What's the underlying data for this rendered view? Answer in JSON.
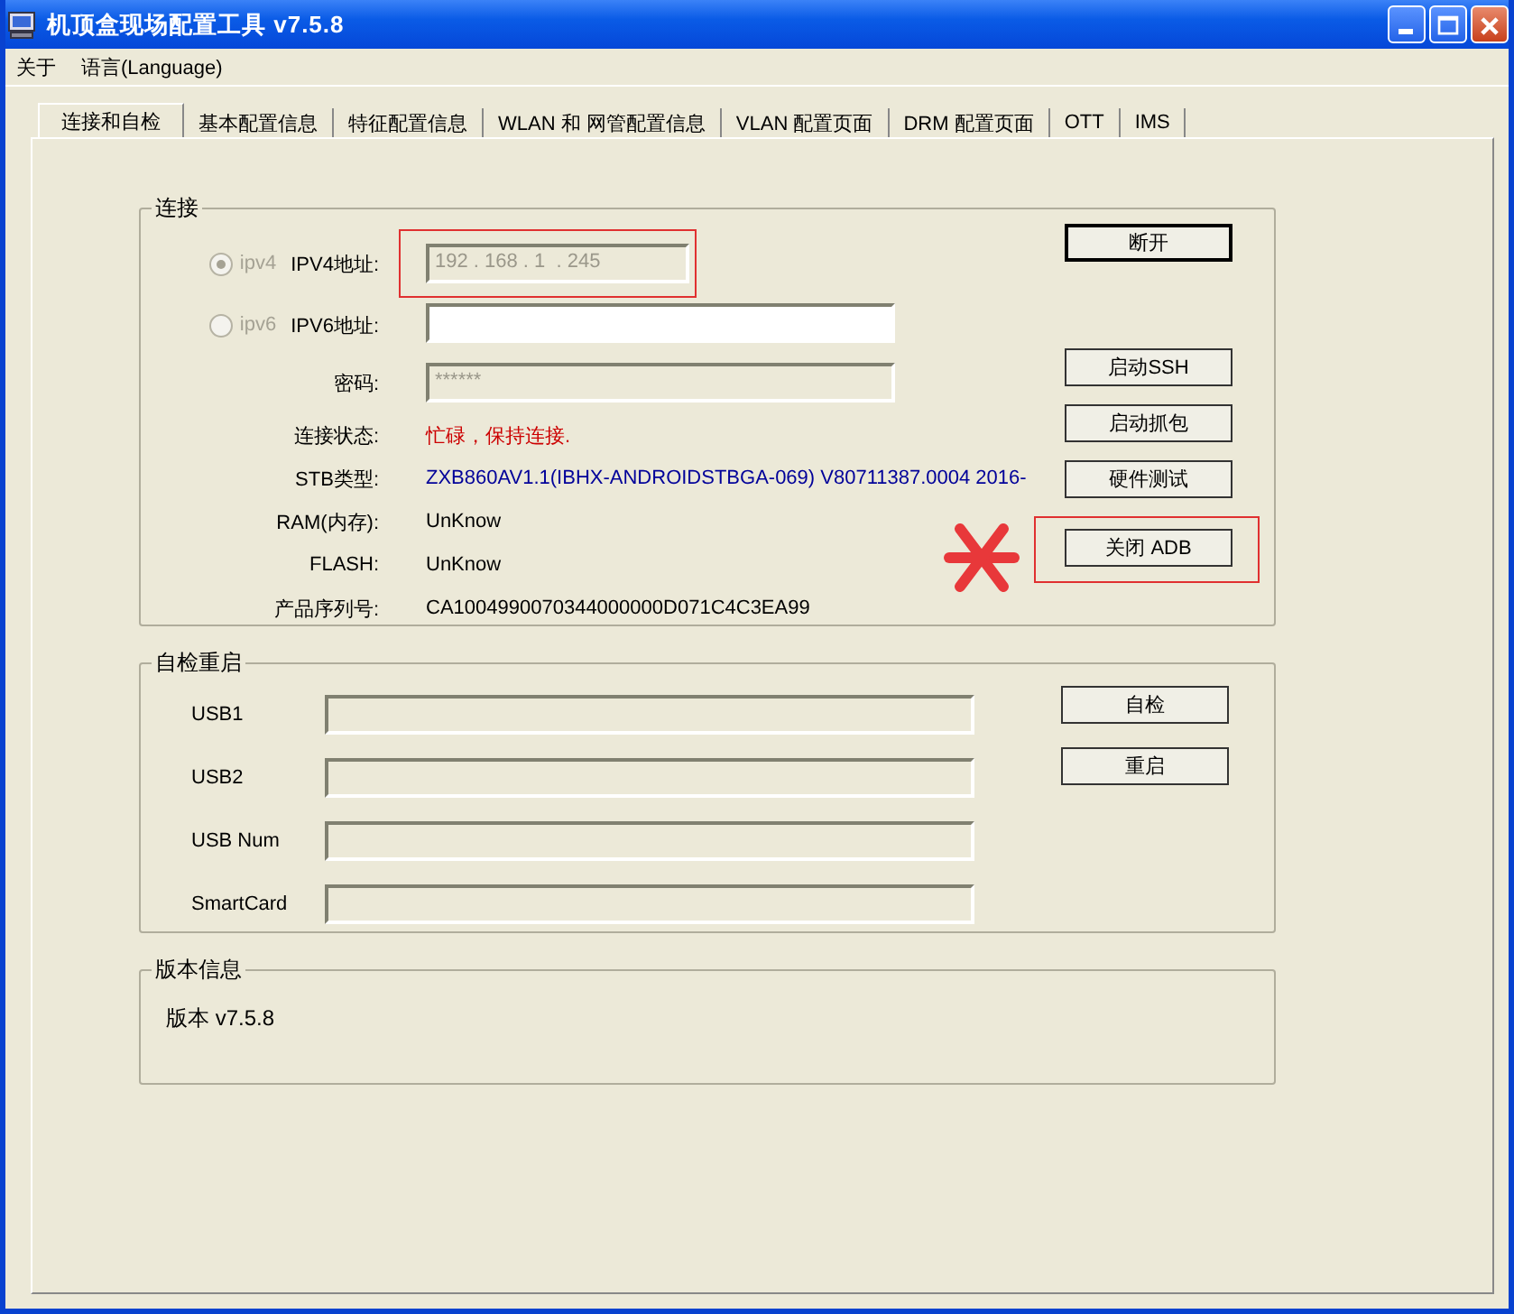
{
  "window": {
    "title": "机顶盒现场配置工具 v7.5.8"
  },
  "menu": [
    "关于",
    "语言(Language)"
  ],
  "tabs": [
    {
      "label": "连接和自检",
      "selected": true
    },
    {
      "label": "基本配置信息",
      "selected": false
    },
    {
      "label": "特征配置信息",
      "selected": false
    },
    {
      "label": "WLAN 和 网管配置信息",
      "selected": false
    },
    {
      "label": "VLAN 配置页面",
      "selected": false
    },
    {
      "label": "DRM 配置页面",
      "selected": false
    },
    {
      "label": "OTT",
      "selected": false
    },
    {
      "label": "IMS",
      "selected": false
    }
  ],
  "connection": {
    "title": "连接",
    "rows": [
      {
        "kind": "radio-field",
        "radio": "ipv4",
        "selected": true,
        "label": "IPV4地址:",
        "value": "192 . 168 . 1  . 245",
        "disabled": true,
        "highlighted": true
      },
      {
        "kind": "radio-field",
        "radio": "ipv6",
        "selected": false,
        "label": "IPV6地址:",
        "disabled": false,
        "highlighted": false
      },
      {
        "kind": "field",
        "label": "密码:",
        "value": "******",
        "disabled": true,
        "highlighted": false
      },
      {
        "kind": "text",
        "label": "连接状态:",
        "value": "忙碌，保持连接.",
        "color": "#cc0000"
      },
      {
        "kind": "text",
        "label": "STB类型:",
        "value": "ZXB860AV1.1(IBHX-ANDROIDSTBGA-069) V80711387.0004 2016-",
        "color": "#000099"
      },
      {
        "kind": "text",
        "label": "RAM(内存):",
        "value": "UnKnow",
        "color": "#000000"
      },
      {
        "kind": "text",
        "label": "FLASH:",
        "value": "UnKnow",
        "color": "#000000"
      },
      {
        "kind": "text",
        "label": "产品序列号:",
        "value": "CA1004990070344000000D071C4C3EA99",
        "color": "#000000"
      }
    ],
    "buttons": [
      {
        "label": "断开",
        "default": true,
        "highlighted": false
      },
      {
        "label": "启动SSH",
        "default": false,
        "highlighted": false
      },
      {
        "label": "启动抓包",
        "default": false,
        "highlighted": false
      },
      {
        "label": "硬件测试",
        "default": false,
        "highlighted": false
      },
      {
        "label": "关闭 ADB",
        "default": false,
        "highlighted": true
      }
    ]
  },
  "self_check": {
    "title": "自检重启",
    "fields": [
      {
        "label": "USB1"
      },
      {
        "label": "USB2"
      },
      {
        "label": "USB Num"
      },
      {
        "label": "SmartCard"
      }
    ],
    "buttons": [
      "自检",
      "重启"
    ]
  },
  "version": {
    "title": "版本信息",
    "text": "版本 v7.5.8"
  }
}
